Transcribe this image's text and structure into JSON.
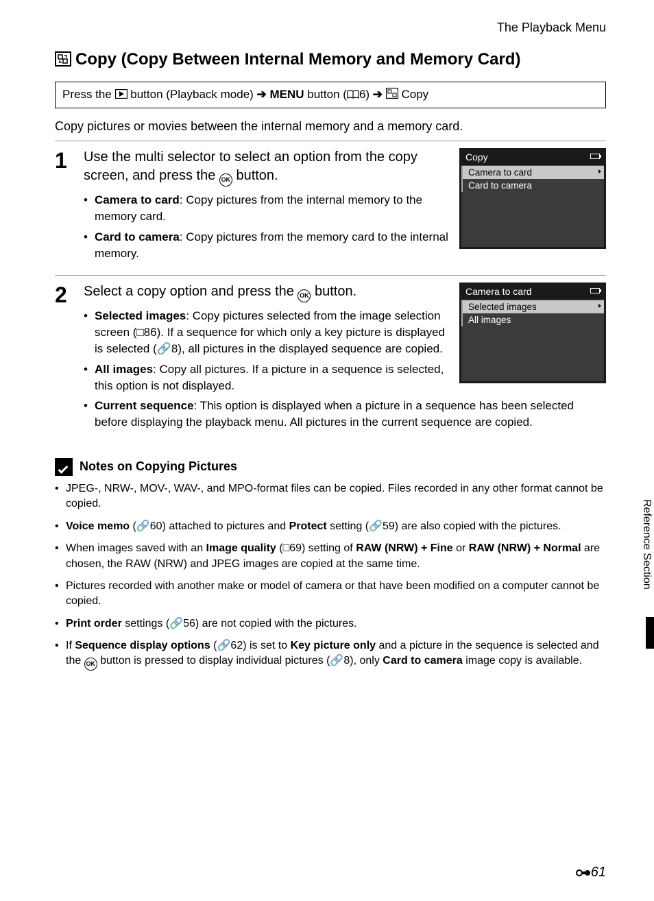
{
  "header": "The Playback Menu",
  "title": "Copy (Copy Between Internal Memory and Memory Card)",
  "breadcrumb": {
    "t1": "Press the ",
    "t2": " button (Playback mode) ",
    "t3": " MENU",
    "t4": " button (",
    "t5": "6) ",
    "t6": " Copy"
  },
  "intro": "Copy pictures or movies between the internal memory and a memory card.",
  "steps": [
    {
      "num": "1",
      "head_a": "Use the multi selector to select an option from the copy screen, and press the ",
      "head_b": " button.",
      "bullets": [
        {
          "b": "Camera to card",
          "t": ": Copy pictures from the internal memory to the memory card."
        },
        {
          "b": "Card to camera",
          "t": ": Copy pictures from the memory card to the internal memory."
        }
      ],
      "screen": {
        "title": "Copy",
        "items": [
          "Camera to card",
          "Card to camera"
        ],
        "selected": 0
      }
    },
    {
      "num": "2",
      "head_a": "Select a copy option and press the ",
      "head_b": " button.",
      "bullets": [
        {
          "b": "Selected images",
          "t": ": Copy pictures selected from the image selection screen (□86). If a sequence for which only a key picture is displayed is selected (🔗8), all pictures in the displayed sequence are copied."
        },
        {
          "b": "All images",
          "t": ": Copy all pictures. If a picture in a sequence is selected, this option is not displayed."
        },
        {
          "b": "Current sequence",
          "t": ": This option is displayed when a picture in a sequence has been selected before displaying the playback menu. All pictures in the current sequence are copied."
        }
      ],
      "screen": {
        "title": "Camera to card",
        "items": [
          "Selected images",
          "All images"
        ],
        "selected": 0
      }
    }
  ],
  "notes": {
    "title": "Notes on Copying Pictures",
    "items": [
      "JPEG-, NRW-, MOV-, WAV-, and MPO-format files can be copied. Files recorded in any other format cannot be copied.",
      "<b>Voice memo</b> (🔗60) attached to pictures and <b>Protect</b> setting (🔗59) are also copied with the pictures.",
      "When images saved with an <b>Image quality</b> (□69) setting of <b>RAW (NRW) + Fine</b> or <b>RAW (NRW) + Normal</b> are chosen, the RAW (NRW) and JPEG images are copied at the same time.",
      "Pictures recorded with another make or model of camera or that have been modified on a computer cannot be copied.",
      "<b>Print order</b> settings (🔗56) are not copied with the pictures.",
      "If <b>Sequence display options</b> (🔗62) is set to <b>Key picture only</b> and a picture in the sequence is selected and the <span class='ok-icon'>OK</span> button is pressed to display individual pictures (🔗8), only <b>Card to camera</b> image copy is available."
    ]
  },
  "sidetab": "Reference Section",
  "pagenum_prefix_glyph": "🔗",
  "pagenum": "61"
}
